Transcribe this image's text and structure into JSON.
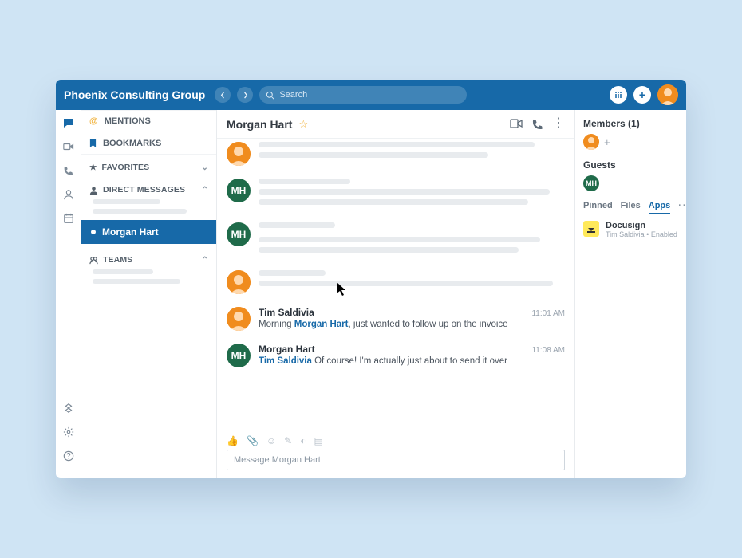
{
  "brand": "Phoenix Consulting Group",
  "search": {
    "placeholder": "Search"
  },
  "sidebar": {
    "mentions": "MENTIONS",
    "bookmarks": "BOOKMARKS",
    "favorites": "FAVORITES",
    "direct_messages": "DIRECT MESSAGES",
    "teams": "TEAMS",
    "active_item": "Morgan Hart"
  },
  "chat": {
    "title": "Morgan Hart",
    "messages": [
      {
        "author": "Tim Saldivia",
        "time": "11:01 AM",
        "text_prefix": "Morning ",
        "mention": "Morgan Hart",
        "text_suffix": ", just wanted to follow up on the invoice"
      },
      {
        "author": "Morgan Hart",
        "initials": "MH",
        "time": "11:08 AM",
        "mention": "Tim Saldivia",
        "text_suffix": " Of course! I'm actually just about to send it over"
      }
    ],
    "composer_placeholder": "Message Morgan Hart"
  },
  "right": {
    "members_label": "Members (1)",
    "guests_label": "Guests",
    "guest_initials": "MH",
    "tabs": {
      "pinned": "Pinned",
      "files": "Files",
      "apps": "Apps"
    },
    "app": {
      "name": "Docusign",
      "sub": "Tim Saldivia • Enabled"
    }
  }
}
